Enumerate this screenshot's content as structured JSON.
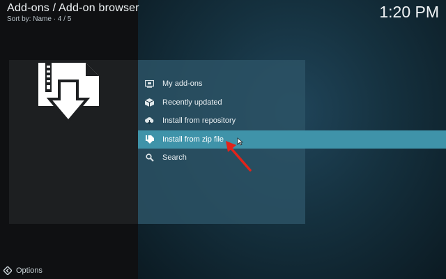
{
  "header": {
    "title": "Add-ons / Add-on browser",
    "subtitle": "Sort by: Name  ·  4 / 5"
  },
  "clock": "1:20 PM",
  "menu": {
    "items": [
      {
        "label": "My add-ons",
        "icon": "monitor-icon"
      },
      {
        "label": "Recently updated",
        "icon": "box-icon"
      },
      {
        "label": "Install from repository",
        "icon": "cloud-download-icon"
      },
      {
        "label": "Install from zip file",
        "icon": "zip-file-icon"
      },
      {
        "label": "Search",
        "icon": "search-icon"
      }
    ],
    "focused_index": 3
  },
  "footer": {
    "options_label": "Options"
  },
  "colors": {
    "accent": "#3f93a9",
    "annotation_arrow": "#e2231a"
  }
}
